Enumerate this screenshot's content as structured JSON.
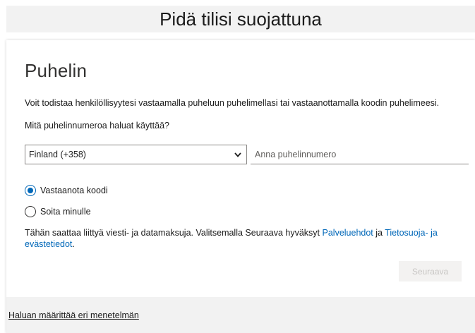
{
  "header": {
    "title": "Pidä tilisi suojattuna"
  },
  "card": {
    "title": "Puhelin",
    "description": "Voit todistaa henkilöllisyytesi vastaamalla puheluun puhelimellasi tai vastaanottamalla koodin puhelimeesi.",
    "question": "Mitä puhelinnumeroa haluat käyttää?",
    "country_select": {
      "value": "Finland (+358)",
      "icon": "chevron-down-icon"
    },
    "phone_input": {
      "value": "",
      "placeholder": "Anna puhelinnumero"
    },
    "options": [
      {
        "label": "Vastaanota koodi",
        "checked": true
      },
      {
        "label": "Soita minulle",
        "checked": false
      }
    ],
    "terms": {
      "prefix": "Tähän saattaa liittyä viesti- ja datamaksuja. Valitsemalla Seuraava hyväksyt ",
      "link_terms": "Palveluehdot",
      "middle": " ja ",
      "link_privacy": "Tietosuoja- ja evästetiedot",
      "suffix": "."
    },
    "next_button_label": "Seuraava",
    "colors": {
      "accent": "#0067b8",
      "disabled_text": "#c8c6c4",
      "header_bg": "#f2f2f2"
    }
  },
  "footer": {
    "link": "Haluan määrittää eri menetelmän"
  }
}
